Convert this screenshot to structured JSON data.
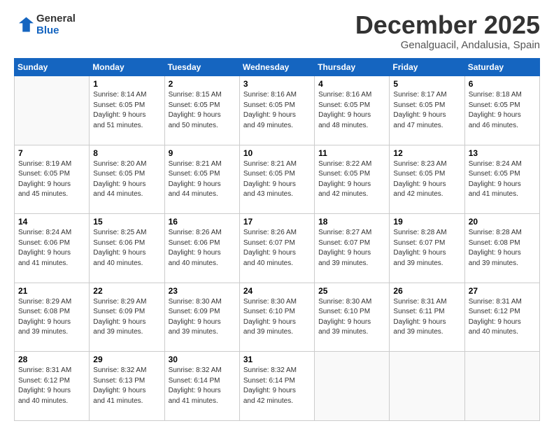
{
  "logo": {
    "line1": "General",
    "line2": "Blue"
  },
  "title": "December 2025",
  "subtitle": "Genalguacil, Andalusia, Spain",
  "days_header": [
    "Sunday",
    "Monday",
    "Tuesday",
    "Wednesday",
    "Thursday",
    "Friday",
    "Saturday"
  ],
  "weeks": [
    [
      {
        "day": "",
        "info": ""
      },
      {
        "day": "1",
        "info": "Sunrise: 8:14 AM\nSunset: 6:05 PM\nDaylight: 9 hours\nand 51 minutes."
      },
      {
        "day": "2",
        "info": "Sunrise: 8:15 AM\nSunset: 6:05 PM\nDaylight: 9 hours\nand 50 minutes."
      },
      {
        "day": "3",
        "info": "Sunrise: 8:16 AM\nSunset: 6:05 PM\nDaylight: 9 hours\nand 49 minutes."
      },
      {
        "day": "4",
        "info": "Sunrise: 8:16 AM\nSunset: 6:05 PM\nDaylight: 9 hours\nand 48 minutes."
      },
      {
        "day": "5",
        "info": "Sunrise: 8:17 AM\nSunset: 6:05 PM\nDaylight: 9 hours\nand 47 minutes."
      },
      {
        "day": "6",
        "info": "Sunrise: 8:18 AM\nSunset: 6:05 PM\nDaylight: 9 hours\nand 46 minutes."
      }
    ],
    [
      {
        "day": "7",
        "info": "Sunrise: 8:19 AM\nSunset: 6:05 PM\nDaylight: 9 hours\nand 45 minutes."
      },
      {
        "day": "8",
        "info": "Sunrise: 8:20 AM\nSunset: 6:05 PM\nDaylight: 9 hours\nand 44 minutes."
      },
      {
        "day": "9",
        "info": "Sunrise: 8:21 AM\nSunset: 6:05 PM\nDaylight: 9 hours\nand 44 minutes."
      },
      {
        "day": "10",
        "info": "Sunrise: 8:21 AM\nSunset: 6:05 PM\nDaylight: 9 hours\nand 43 minutes."
      },
      {
        "day": "11",
        "info": "Sunrise: 8:22 AM\nSunset: 6:05 PM\nDaylight: 9 hours\nand 42 minutes."
      },
      {
        "day": "12",
        "info": "Sunrise: 8:23 AM\nSunset: 6:05 PM\nDaylight: 9 hours\nand 42 minutes."
      },
      {
        "day": "13",
        "info": "Sunrise: 8:24 AM\nSunset: 6:05 PM\nDaylight: 9 hours\nand 41 minutes."
      }
    ],
    [
      {
        "day": "14",
        "info": "Sunrise: 8:24 AM\nSunset: 6:06 PM\nDaylight: 9 hours\nand 41 minutes."
      },
      {
        "day": "15",
        "info": "Sunrise: 8:25 AM\nSunset: 6:06 PM\nDaylight: 9 hours\nand 40 minutes."
      },
      {
        "day": "16",
        "info": "Sunrise: 8:26 AM\nSunset: 6:06 PM\nDaylight: 9 hours\nand 40 minutes."
      },
      {
        "day": "17",
        "info": "Sunrise: 8:26 AM\nSunset: 6:07 PM\nDaylight: 9 hours\nand 40 minutes."
      },
      {
        "day": "18",
        "info": "Sunrise: 8:27 AM\nSunset: 6:07 PM\nDaylight: 9 hours\nand 39 minutes."
      },
      {
        "day": "19",
        "info": "Sunrise: 8:28 AM\nSunset: 6:07 PM\nDaylight: 9 hours\nand 39 minutes."
      },
      {
        "day": "20",
        "info": "Sunrise: 8:28 AM\nSunset: 6:08 PM\nDaylight: 9 hours\nand 39 minutes."
      }
    ],
    [
      {
        "day": "21",
        "info": "Sunrise: 8:29 AM\nSunset: 6:08 PM\nDaylight: 9 hours\nand 39 minutes."
      },
      {
        "day": "22",
        "info": "Sunrise: 8:29 AM\nSunset: 6:09 PM\nDaylight: 9 hours\nand 39 minutes."
      },
      {
        "day": "23",
        "info": "Sunrise: 8:30 AM\nSunset: 6:09 PM\nDaylight: 9 hours\nand 39 minutes."
      },
      {
        "day": "24",
        "info": "Sunrise: 8:30 AM\nSunset: 6:10 PM\nDaylight: 9 hours\nand 39 minutes."
      },
      {
        "day": "25",
        "info": "Sunrise: 8:30 AM\nSunset: 6:10 PM\nDaylight: 9 hours\nand 39 minutes."
      },
      {
        "day": "26",
        "info": "Sunrise: 8:31 AM\nSunset: 6:11 PM\nDaylight: 9 hours\nand 39 minutes."
      },
      {
        "day": "27",
        "info": "Sunrise: 8:31 AM\nSunset: 6:12 PM\nDaylight: 9 hours\nand 40 minutes."
      }
    ],
    [
      {
        "day": "28",
        "info": "Sunrise: 8:31 AM\nSunset: 6:12 PM\nDaylight: 9 hours\nand 40 minutes."
      },
      {
        "day": "29",
        "info": "Sunrise: 8:32 AM\nSunset: 6:13 PM\nDaylight: 9 hours\nand 41 minutes."
      },
      {
        "day": "30",
        "info": "Sunrise: 8:32 AM\nSunset: 6:14 PM\nDaylight: 9 hours\nand 41 minutes."
      },
      {
        "day": "31",
        "info": "Sunrise: 8:32 AM\nSunset: 6:14 PM\nDaylight: 9 hours\nand 42 minutes."
      },
      {
        "day": "",
        "info": ""
      },
      {
        "day": "",
        "info": ""
      },
      {
        "day": "",
        "info": ""
      }
    ]
  ]
}
